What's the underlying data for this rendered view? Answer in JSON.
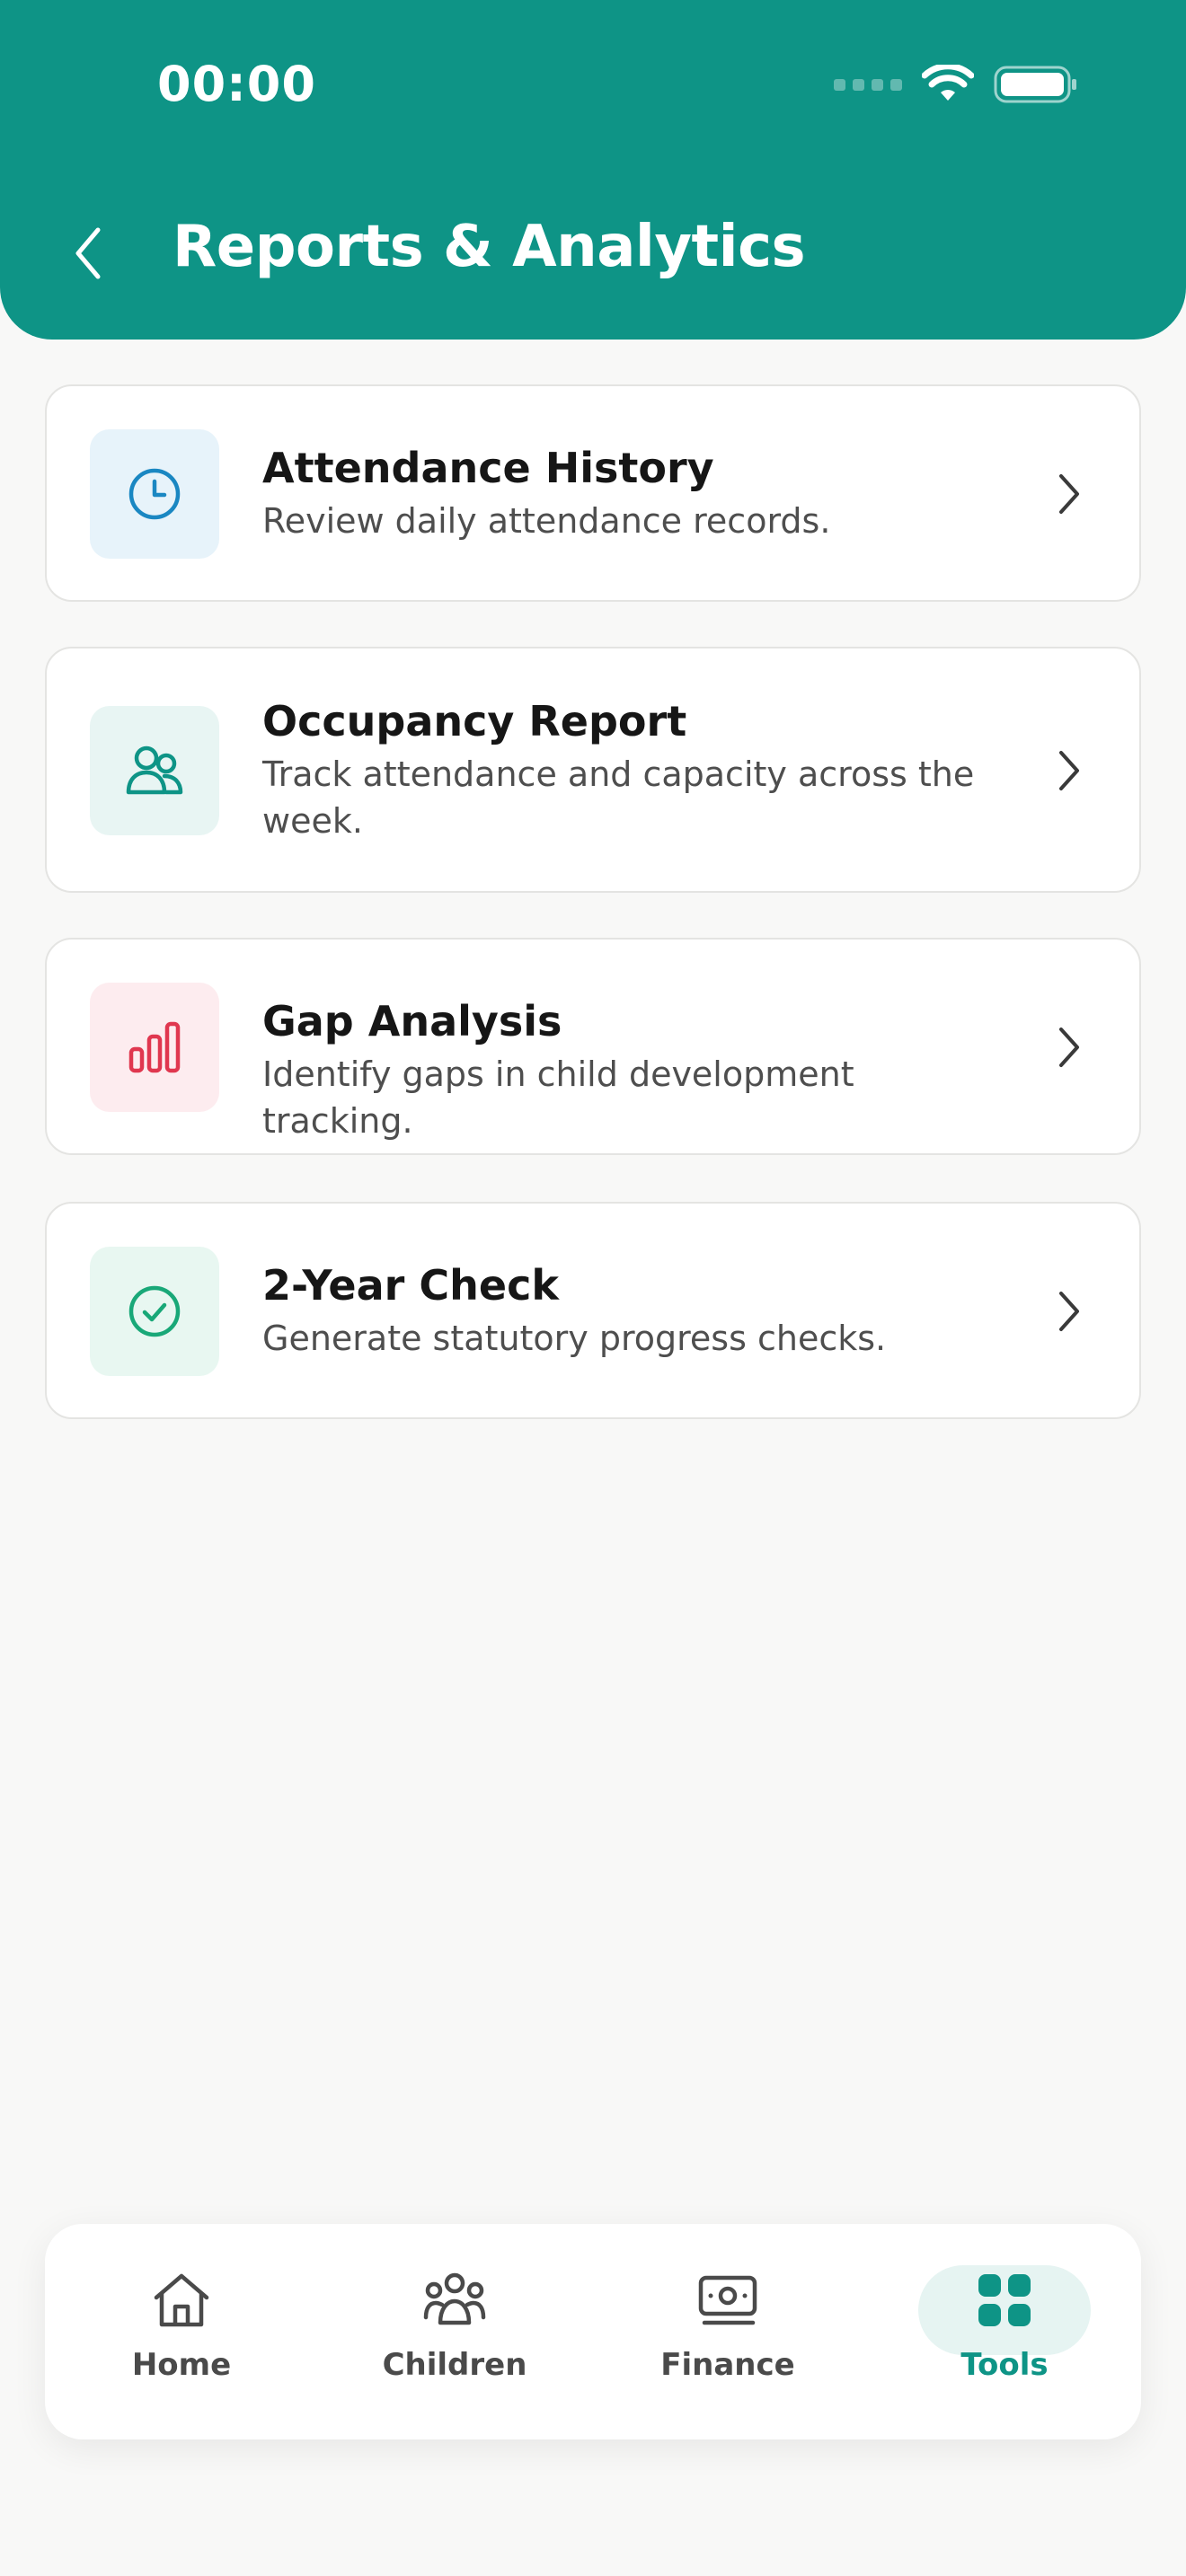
{
  "status_bar": {
    "time": "00:00"
  },
  "header": {
    "title": "Reports & Analytics"
  },
  "reports": [
    {
      "title": "Attendance History",
      "description": "Review daily attendance records.",
      "icon": "clock-icon",
      "icon_color": "#1a87c2",
      "icon_bg": "#e7f3fa"
    },
    {
      "title": "Occupancy Report",
      "description": "Track attendance and capacity across the week.",
      "icon": "people-icon",
      "icon_color": "#0e9486",
      "icon_bg": "#e8f5f3"
    },
    {
      "title": "Gap Analysis",
      "description": "Identify gaps in child development tracking.",
      "icon": "bar-chart-icon",
      "icon_color": "#e0374f",
      "icon_bg": "#fdecef"
    },
    {
      "title": "2-Year Check",
      "description": "Generate statutory progress checks.",
      "icon": "check-circle-icon",
      "icon_color": "#19a878",
      "icon_bg": "#e8f7f1"
    }
  ],
  "bottom_nav": {
    "items": [
      {
        "label": "Home",
        "icon": "home-icon"
      },
      {
        "label": "Children",
        "icon": "children-icon"
      },
      {
        "label": "Finance",
        "icon": "banknote-icon"
      },
      {
        "label": "Tools",
        "icon": "grid-icon",
        "active": true
      }
    ]
  },
  "colors": {
    "brand": "#0e9486",
    "background": "#f8f8f7",
    "active_pill": "#e6f4f2"
  }
}
